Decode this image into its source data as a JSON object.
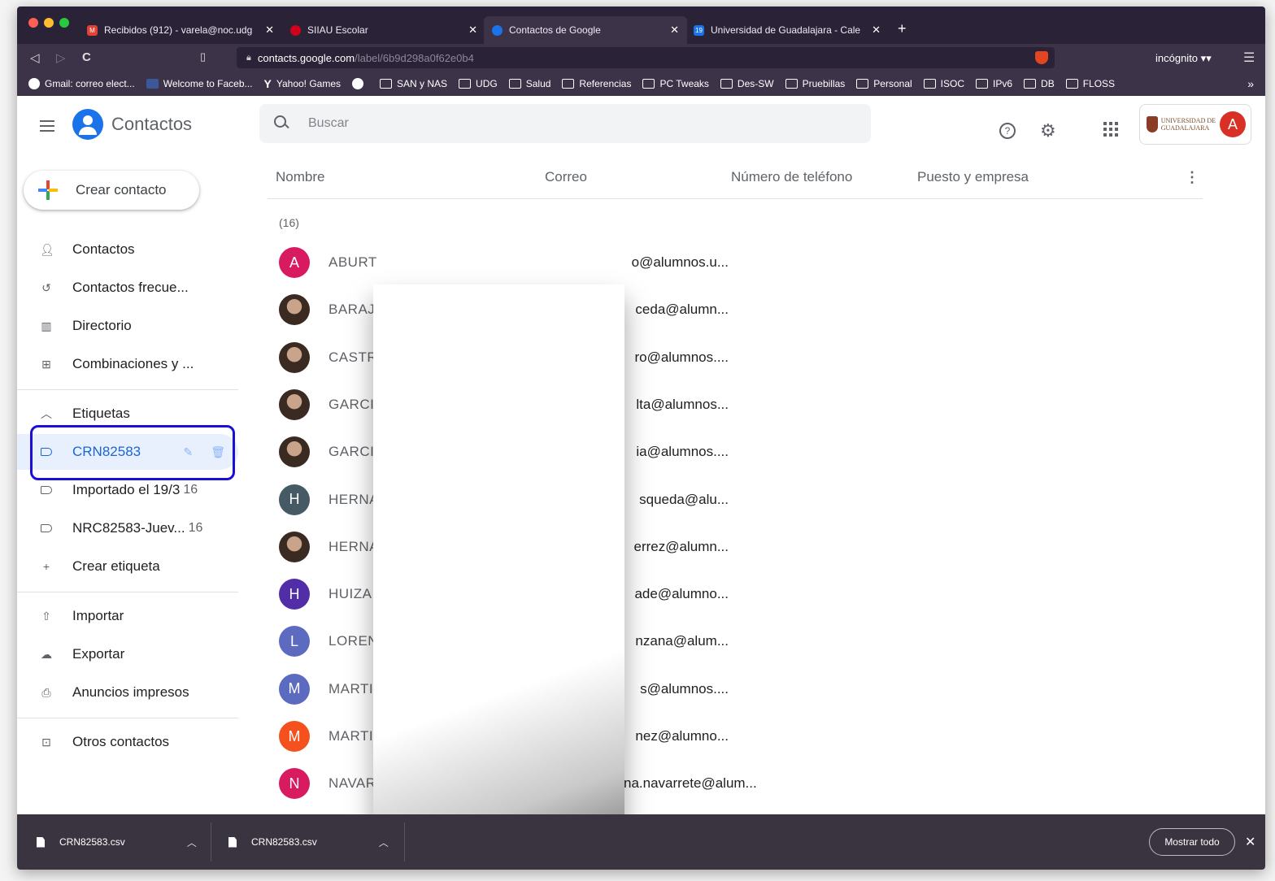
{
  "browser": {
    "tabs": [
      {
        "title": "Recibidos (912) - varela@noc.udg",
        "icon_color": "#e34133"
      },
      {
        "title": "SIIAU Escolar",
        "icon_color": "#d0021b"
      },
      {
        "title": "Contactos de Google",
        "icon_color": "#1a73e8"
      },
      {
        "title": "Universidad de Guadalajara - Cale",
        "icon_color": "#1a73e8",
        "icon_text": "19"
      }
    ],
    "url_host": "contacts.google.com",
    "url_path": "/label/6b9d298a0f62e0b4",
    "incognito": "incógnito",
    "bookmarks": [
      "Gmail: correo elect...",
      "Welcome to Faceb...",
      "Yahoo! Games",
      "",
      "SAN y NAS",
      "UDG",
      "Salud",
      "Referencias",
      "PC Tweaks",
      "Des-SW",
      "Pruebillas",
      "Personal",
      "ISOC",
      "IPv6",
      "DB",
      "FLOSS"
    ],
    "bookmarks_more": "»"
  },
  "header": {
    "app_title": "Contactos",
    "search_placeholder": "Buscar",
    "account_initial": "A",
    "org_logo_text": "UNIVERSIDAD DE GUADALAJARA"
  },
  "sidebar": {
    "create_label": "Crear contacto",
    "items": [
      {
        "label": "Contactos",
        "icon": "person-icon"
      },
      {
        "label": "Contactos frecue...",
        "icon": "history-icon"
      },
      {
        "label": "Directorio",
        "icon": "directory-icon"
      },
      {
        "label": "Combinaciones y ...",
        "icon": "merge-icon"
      }
    ],
    "labels_heading": "Etiquetas",
    "labels": [
      {
        "label": "CRN82583",
        "count": ""
      },
      {
        "label": "Importado el 19/3",
        "count": "16"
      },
      {
        "label": "NRC82583-Juev...",
        "count": "16"
      }
    ],
    "create_label_text": "Crear etiqueta",
    "tools": [
      {
        "label": "Importar",
        "icon": "upload-icon"
      },
      {
        "label": "Exportar",
        "icon": "cloud-download-icon"
      },
      {
        "label": "Anuncios impresos",
        "icon": "print-icon"
      }
    ],
    "other_contacts": "Otros contactos"
  },
  "table": {
    "columns": [
      "Nombre",
      "Correo",
      "Número de teléfono",
      "Puesto y empresa"
    ],
    "count": "(16)",
    "rows": [
      {
        "initial": "A",
        "avatar_color": "#d81b60",
        "name": "ABURT",
        "email": "o@alumnos.u..."
      },
      {
        "initial": "",
        "avatar_color": "photo",
        "name": "BARAJ",
        "email": "ceda@alumn..."
      },
      {
        "initial": "",
        "avatar_color": "photo",
        "name": "CASTR",
        "email": "ro@alumnos...."
      },
      {
        "initial": "",
        "avatar_color": "photo",
        "name": "GARCI",
        "email": "lta@alumnos..."
      },
      {
        "initial": "",
        "avatar_color": "photo",
        "name": "GARCI",
        "email": "ia@alumnos...."
      },
      {
        "initial": "H",
        "avatar_color": "#455a64",
        "name": "HERNA",
        "email": "squeda@alu..."
      },
      {
        "initial": "",
        "avatar_color": "photo",
        "name": "HERNA",
        "email": "errez@alumn..."
      },
      {
        "initial": "H",
        "avatar_color": "#512da8",
        "name": "HUIZA",
        "email": "ade@alumno..."
      },
      {
        "initial": "L",
        "avatar_color": "#5c6bc0",
        "name": "LOREN",
        "email": "nzana@alum..."
      },
      {
        "initial": "M",
        "avatar_color": "#5c6bc0",
        "name": "MARTI",
        "email": "s@alumnos...."
      },
      {
        "initial": "M",
        "avatar_color": "#f4511e",
        "name": "MARTI",
        "email": "nez@alumno..."
      },
      {
        "initial": "N",
        "avatar_color": "#d81b60",
        "name": "NAVARRE",
        "email": "na.navarrete@alum..."
      }
    ]
  },
  "downloads": {
    "items": [
      "CRN82583.csv",
      "CRN82583.csv"
    ],
    "show_all": "Mostrar todo"
  }
}
